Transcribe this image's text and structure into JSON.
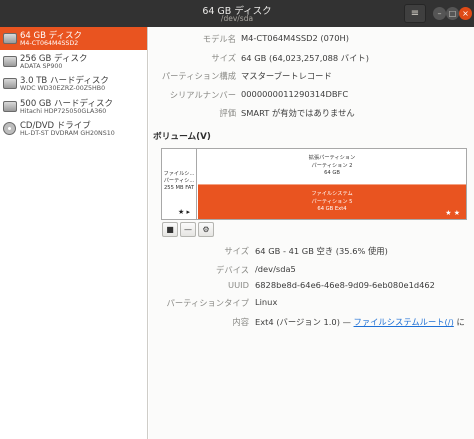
{
  "window": {
    "title": "64 GB ディスク",
    "subtitle": "/dev/sda",
    "menu_icon": "hamburger-icon",
    "min_label": "–",
    "max_label": "□",
    "close_label": "×"
  },
  "sidebar": {
    "disks": [
      {
        "name": "64 GB ディスク",
        "model": "M4-CT064M4SSD2",
        "icon": "hard-disk-icon"
      },
      {
        "name": "256 GB ディスク",
        "model": "ADATA SP900",
        "icon": "hard-disk-icon"
      },
      {
        "name": "3.0 TB ハードディスク",
        "model": "WDC WD30EZRZ-00Z5HB0",
        "icon": "hard-disk-icon"
      },
      {
        "name": "500 GB ハードディスク",
        "model": "Hitachi HDP725050GLA360",
        "icon": "hard-disk-icon"
      },
      {
        "name": "CD/DVD ドライブ",
        "model": "HL-DT-ST DVDRAM GH20NS10",
        "icon": "optical-drive-icon"
      }
    ]
  },
  "disk_info": [
    {
      "label": "モデル名",
      "value": "M4-CT064M4SSD2 (070H)"
    },
    {
      "label": "サイズ",
      "value": "64 GB (64,023,257,088 バイト)"
    },
    {
      "label": "パーティション構成",
      "value": "マスターブートレコード"
    },
    {
      "label": "シリアルナンバー",
      "value": "0000000011290314DBFC"
    },
    {
      "label": "評価",
      "value": "SMART が有効ではありません"
    }
  ],
  "volumes": {
    "header": "ボリューム(V)",
    "partition1": {
      "line1": "ファイルシ...",
      "line2": "パーティシ...",
      "line3": "255 MB FAT",
      "stars": "★ ▸"
    },
    "extended": {
      "line1": "拡張パーティション",
      "line2": "パーティション 2",
      "line3": "64 GB"
    },
    "logical": {
      "line1": "ファイルシステム",
      "line2": "パーティション 5",
      "line3": "64 GB Ext4",
      "stars": "★ ★"
    },
    "toolbar": {
      "stop": "■",
      "remove": "—",
      "settings": "⚙"
    }
  },
  "volume_info": {
    "size": {
      "label": "サイズ",
      "value": "64 GB - 41 GB 空き (35.6% 使用)"
    },
    "device": {
      "label": "デバイス",
      "value": "/dev/sda5"
    },
    "uuid": {
      "label": "UUID",
      "value": "6828be8d-64e6-46e8-9d09-6eb080e1d462"
    },
    "ptype": {
      "label": "パーティションタイプ",
      "value": "Linux"
    },
    "content": {
      "label": "内容",
      "value_prefix": "Ext4 (バージョン 1.0) — ",
      "link": "ファイルシステムルート(/)",
      "value_suffix": " に"
    }
  },
  "colors": {
    "accent": "#e95420",
    "titlebar": "#323232",
    "link": "#1d6fd5"
  }
}
